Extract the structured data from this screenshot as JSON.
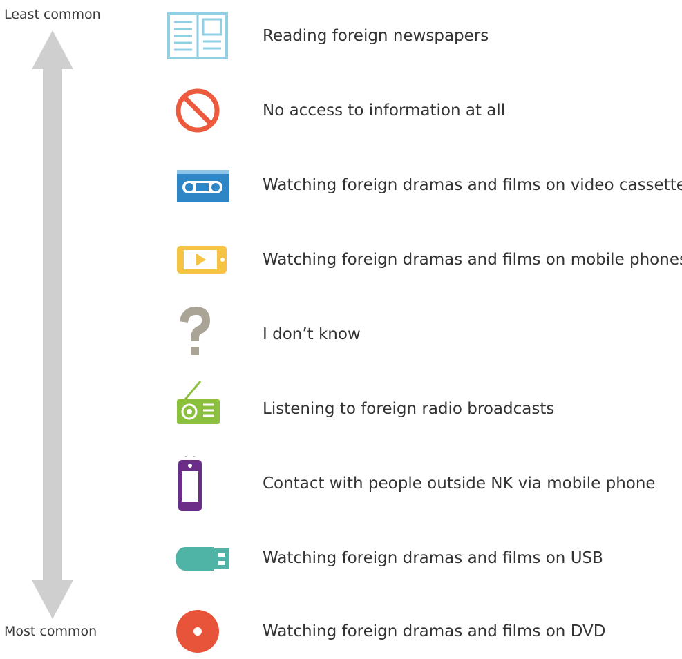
{
  "scale": {
    "top_label": "Least common",
    "bottom_label": "Most common",
    "arrow_color": "#cfcfcf"
  },
  "items": [
    {
      "icon": "newspaper-icon",
      "label": "Reading foreign newspapers",
      "color": "#8fd0e4"
    },
    {
      "icon": "no-access-icon",
      "label": "No access to information at all",
      "color": "#ee5a3d"
    },
    {
      "icon": "video-cassette-icon",
      "label": "Watching foreign dramas and films on video cassettes",
      "color": "#2f86c6"
    },
    {
      "icon": "mobile-phone-landscape-icon",
      "label": "Watching foreign dramas and films on mobile phones",
      "color": "#f6c445"
    },
    {
      "icon": "question-mark-icon",
      "label": "I don’t know",
      "color": "#a9a496"
    },
    {
      "icon": "radio-icon",
      "label": "Listening to foreign radio broadcasts",
      "color": "#8bbf3e"
    },
    {
      "icon": "ringing-phone-icon",
      "label": "Contact with people outside NK via mobile phone",
      "color": "#6b2d87"
    },
    {
      "icon": "usb-icon",
      "label": "Watching foreign dramas and films on USB",
      "color": "#4fb3a6"
    },
    {
      "icon": "dvd-icon",
      "label": "Watching foreign dramas and films on DVD",
      "color": "#e8543a"
    }
  ]
}
